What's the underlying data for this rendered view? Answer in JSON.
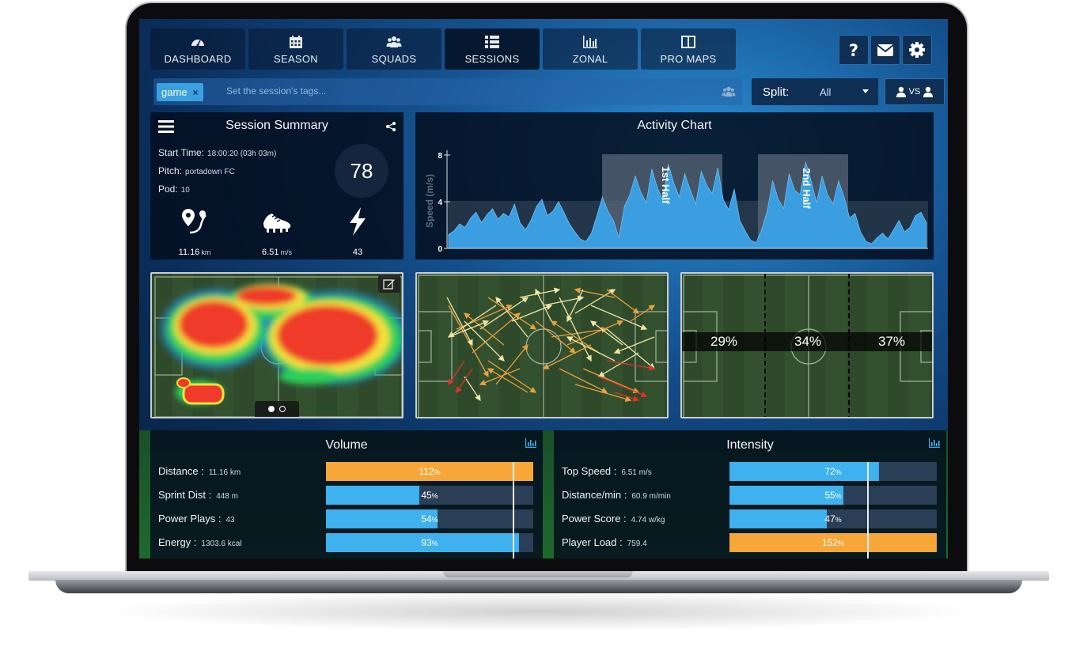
{
  "nav": {
    "tabs": [
      {
        "label": "DASHBOARD",
        "icon": "gauge-icon"
      },
      {
        "label": "SEASON",
        "icon": "calendar-icon"
      },
      {
        "label": "SQUADS",
        "icon": "group-icon"
      },
      {
        "label": "SESSIONS",
        "icon": "list-icon",
        "active": true
      },
      {
        "label": "ZONAL",
        "icon": "bar-chart-icon"
      },
      {
        "label": "PRO MAPS",
        "icon": "split-panel-icon"
      }
    ],
    "buttons": [
      "help-icon",
      "mail-icon",
      "gear-icon"
    ]
  },
  "tags": {
    "chip": "game",
    "remove": "×",
    "placeholder": "Set the session's tags..."
  },
  "split": {
    "label": "Split:",
    "value": "All"
  },
  "vs": {
    "label": "VS"
  },
  "summary": {
    "title": "Session Summary",
    "start_label": "Start Time:",
    "start_value": "18:00:20 (03h 03m)",
    "pitch_label": "Pitch:",
    "pitch_value": "portadown FC",
    "pod_label": "Pod:",
    "pod_value": "10",
    "score": "78",
    "distance_value": "11.16",
    "distance_unit": "km",
    "speed_value": "6.51",
    "speed_unit": "m/s",
    "power_value": "43"
  },
  "activity": {
    "title": "Activity Chart",
    "ylabel": "Speed (m/s)",
    "first_half": "1st Half",
    "second_half": "2nd Half"
  },
  "chart_data": {
    "type": "area",
    "title": "Activity Chart",
    "ylabel": "Speed (m/s)",
    "ylim": [
      0,
      8
    ],
    "yticks": [
      0,
      4,
      8
    ],
    "annotations": [
      "1st Half",
      "2nd Half"
    ],
    "y": [
      1.2,
      1.5,
      2.1,
      1.8,
      2.6,
      3.1,
      2.2,
      2.9,
      3.4,
      2.5,
      3.0,
      2.7,
      3.8,
      2.2,
      1.6,
      2.4,
      3.6,
      4.2,
      2.8,
      3.2,
      4.0,
      3.1,
      2.1,
      1.4,
      0.8,
      0.6,
      1.3,
      2.8,
      4.4,
      3.2,
      2.4,
      0.9,
      3.6,
      4.6,
      6.2,
      4.8,
      3.9,
      6.8,
      5.2,
      4.1,
      7.2,
      5.6,
      4.4,
      6.4,
      5.0,
      3.8,
      6.6,
      5.4,
      4.7,
      6.9,
      4.2,
      3.3,
      5.1,
      2.4,
      1.5,
      0.7,
      0.5,
      1.6,
      3.2,
      5.8,
      4.2,
      3.4,
      6.4,
      5.0,
      4.6,
      7.4,
      5.8,
      3.9,
      6.2,
      4.6,
      3.8,
      5.8,
      4.4,
      2.6,
      3.0,
      1.4,
      0.6,
      0.4,
      0.9,
      1.3,
      0.8,
      1.6,
      2.4,
      1.4,
      1.8,
      2.8,
      3.1,
      2.2
    ]
  },
  "zonal": {
    "zones": [
      "29%",
      "34%",
      "37%"
    ]
  },
  "volume": {
    "title": "Volume",
    "rows": [
      {
        "label": "Distance :",
        "value": "11.16 km",
        "pct": 112,
        "pct_num": "112",
        "pct_sign": "%",
        "color": "#f7a73a"
      },
      {
        "label": "Sprint Dist :",
        "value": "448 m",
        "pct": 45,
        "pct_num": "45",
        "pct_sign": "%",
        "color": "#3eb1ee"
      },
      {
        "label": "Power Plays :",
        "value": "43",
        "pct": 54,
        "pct_num": "54",
        "pct_sign": "%",
        "color": "#3eb1ee"
      },
      {
        "label": "Energy :",
        "value": "1303.6 kcal",
        "pct": 93,
        "pct_num": "93",
        "pct_sign": "%",
        "color": "#3eb1ee"
      }
    ]
  },
  "intensity": {
    "title": "Intensity",
    "rows": [
      {
        "label": "Top Speed :",
        "value": "6.51 m/s",
        "pct": 72,
        "pct_num": "72",
        "pct_sign": "%",
        "color": "#3eb1ee"
      },
      {
        "label": "Distance/min :",
        "value": "60.9 m/min",
        "pct": 55,
        "pct_num": "55",
        "pct_sign": "%",
        "color": "#3eb1ee"
      },
      {
        "label": "Power Score :",
        "value": "4.74 w/kg",
        "pct": 47,
        "pct_num": "47",
        "pct_sign": "%",
        "color": "#3eb1ee"
      },
      {
        "label": "Player Load :",
        "value": "759.4",
        "pct": 152,
        "pct_num": "152",
        "pct_sign": "%",
        "color": "#f7a73a"
      }
    ]
  }
}
